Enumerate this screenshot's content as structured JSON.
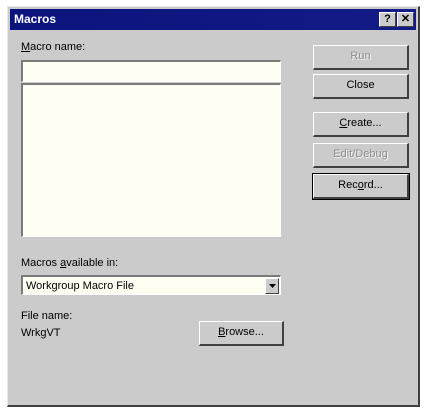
{
  "window": {
    "title": "Macros",
    "help_glyph": "?",
    "close_glyph": "✕"
  },
  "macro_name": {
    "label_prefix": "",
    "label_u": "M",
    "label_rest": "acro name:",
    "value": "",
    "list_items": []
  },
  "buttons": {
    "run": "Run",
    "close": "Close",
    "create_u": "C",
    "create_rest": "reate...",
    "edit_debug": "Edit/Debug",
    "record_pre": "Rec",
    "record_u": "o",
    "record_rest": "rd...",
    "browse_u": "B",
    "browse_rest": "rowse..."
  },
  "available_in": {
    "label_pre": "Macros ",
    "label_u": "a",
    "label_rest": "vailable in:",
    "value": "Workgroup Macro File"
  },
  "file": {
    "label": "File name:",
    "value": "WrkgVT"
  },
  "icons": {
    "dropdown": "chevron-down-icon"
  }
}
